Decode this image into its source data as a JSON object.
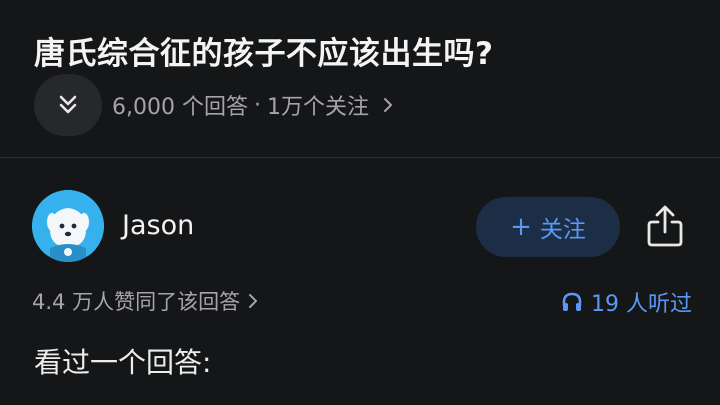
{
  "question": {
    "title": "唐氏综合征的孩子不应该出生吗?",
    "answers_count": "6,000 个回答",
    "separator": "·",
    "followers": "1万个关注"
  },
  "author": {
    "name": "Jason",
    "follow_label": "关注",
    "follow_plus": "+"
  },
  "stats": {
    "likes": "4.4 万人赞同了该回答",
    "listened": "19 人听过"
  },
  "answer": {
    "text": "看过一个回答:"
  },
  "colors": {
    "background": "#151617",
    "accent": "#5b97f4",
    "follow_bg": "#1c2e46",
    "muted_text": "#a5a5a8",
    "avatar_bg": "#35b2ee"
  },
  "icons": {
    "collapse": "double-chevron-down-icon",
    "meta_arrow": "chevron-right-icon",
    "share": "share-icon",
    "likes_arrow": "chevron-right-icon",
    "listen": "headphones-icon"
  }
}
